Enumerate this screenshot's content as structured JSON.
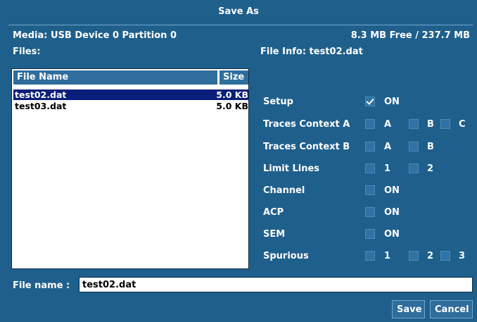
{
  "dialog": {
    "title": "Save As"
  },
  "media": {
    "label": "Media: USB Device 0 Partition 0",
    "free": "8.3 MB Free / 237.7 MB"
  },
  "files": {
    "label": "Files:",
    "columns": {
      "name": "File Name",
      "size": "Size"
    },
    "rows": [
      {
        "name": "test02.dat",
        "size": "5.0 KB",
        "selected": true
      },
      {
        "name": "test03.dat",
        "size": "5.0 KB",
        "selected": false
      }
    ]
  },
  "file_info": {
    "label": "File Info:",
    "file": "test02.dat"
  },
  "options": [
    {
      "label": "Setup",
      "boxes": [
        {
          "text": "ON",
          "checked": true
        }
      ]
    },
    {
      "label": "Traces Context A",
      "boxes": [
        {
          "text": "A",
          "checked": false
        },
        {
          "text": "B",
          "checked": false
        },
        {
          "text": "C",
          "checked": false
        }
      ]
    },
    {
      "label": "Traces Context B",
      "boxes": [
        {
          "text": "A",
          "checked": false
        },
        {
          "text": "B",
          "checked": false
        }
      ]
    },
    {
      "label": "Limit Lines",
      "boxes": [
        {
          "text": "1",
          "checked": false
        },
        {
          "text": "2",
          "checked": false
        }
      ]
    },
    {
      "label": "Channel",
      "boxes": [
        {
          "text": "ON",
          "checked": false
        }
      ]
    },
    {
      "label": "ACP",
      "boxes": [
        {
          "text": "ON",
          "checked": false
        }
      ]
    },
    {
      "label": "SEM",
      "boxes": [
        {
          "text": "ON",
          "checked": false
        }
      ]
    },
    {
      "label": "Spurious",
      "boxes": [
        {
          "text": "1",
          "checked": false
        },
        {
          "text": "2",
          "checked": false
        },
        {
          "text": "3",
          "checked": false
        }
      ]
    }
  ],
  "filename": {
    "label": "File name :",
    "value": "test02.dat"
  },
  "buttons": {
    "save": "Save",
    "cancel": "Cancel"
  }
}
